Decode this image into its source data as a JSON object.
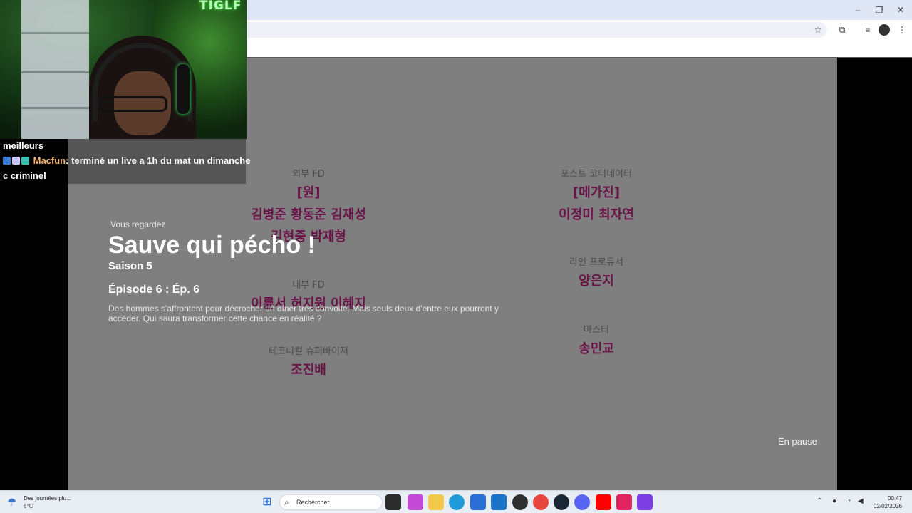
{
  "browser": {
    "window_controls": [
      "–",
      "❐",
      "✕"
    ]
  },
  "webcam": {
    "neon_sign": "TIGLF"
  },
  "chat": {
    "line1": "meilleurs",
    "user": "Macfun",
    "message": ": terminé un live a 1h du mat un dimanche",
    "line3": "c criminel"
  },
  "credits": {
    "left": [
      {
        "role": "외부 FD",
        "names": [
          "[원]",
          "김병준 황동준 김재성",
          "김현중 박재형"
        ]
      },
      {
        "role": "내부 FD",
        "names": [
          "이륜서 허지원 이혜지"
        ]
      },
      {
        "role": "테크니컬 슈퍼바이저",
        "names": [
          "조진배"
        ]
      }
    ],
    "right": [
      {
        "role": "포스트 코디네이터",
        "names": [
          "[메가진]",
          "이정미 최자연"
        ]
      },
      {
        "role": "라인 프로듀서",
        "names": [
          "양은지"
        ]
      },
      {
        "role": "마스터",
        "names": [
          "송민교"
        ]
      }
    ]
  },
  "player": {
    "watching_label": "Vous regardez",
    "title": "Sauve qui pécho !",
    "season": "Saison 5",
    "episode": "Épisode 6 : Ép. 6",
    "description": "Des hommes s'affrontent pour décrocher un dîner très convoité. Mais seuls deux d'entre eux pourront y accéder. Qui saura transformer cette chance en réalité ?",
    "status": "En pause"
  },
  "taskbar": {
    "weather_text": "Des journées plu...",
    "weather_temp": "6°C",
    "search_placeholder": "Rechercher",
    "time": "00:47",
    "date": "02/02/2026"
  },
  "colors": {
    "video_bg": "#7f7f7f",
    "credit_names": "#6a1348",
    "chat_user": "#f3b36a",
    "taskbar_bg": "#e9edf4"
  }
}
